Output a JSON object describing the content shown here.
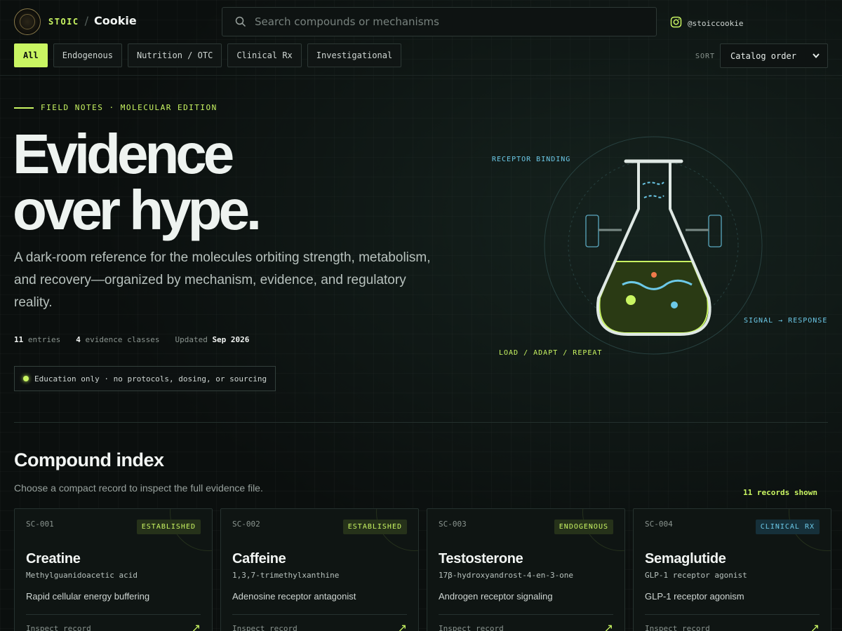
{
  "header": {
    "brand_prefix": "STOIC",
    "brand_separator": "/",
    "brand_name": "Cookie",
    "search_placeholder": "Search compounds or mechanisms",
    "social_handle": "@stoiccookie"
  },
  "filters": [
    {
      "label": "All",
      "active": true
    },
    {
      "label": "Endogenous",
      "active": false
    },
    {
      "label": "Nutrition / OTC",
      "active": false
    },
    {
      "label": "Clinical Rx",
      "active": false
    },
    {
      "label": "Investigational",
      "active": false
    }
  ],
  "sort": {
    "label": "SORT",
    "value": "Catalog order"
  },
  "hero": {
    "kicker": "FIELD NOTES · MOLECULAR EDITION",
    "title_line1": "Evidence",
    "title_line2": "over hype.",
    "subtitle": "A dark-room reference for the molecules orbiting strength, metabolism, and recovery—organized by mechanism, evidence, and regulatory reality.",
    "stats": {
      "entries_count": "11",
      "entries_label": "entries",
      "classes_count": "4",
      "classes_label": "evidence classes",
      "updated_label": "Updated",
      "updated_value": "Sep 2026"
    },
    "disclaimer": "Education only · no protocols, dosing, or sourcing"
  },
  "illustration": {
    "label_top": "RECEPTOR BINDING",
    "label_right": "SIGNAL → RESPONSE",
    "label_bottom": "LOAD / ADAPT / REPEAT"
  },
  "index": {
    "title": "Compound index",
    "subtitle": "Choose a compact record to inspect the full evidence file.",
    "count_text": "11 records shown",
    "cards": [
      {
        "id": "SC-001",
        "badge": "ESTABLISHED",
        "badge_tone": "green",
        "name": "Creatine",
        "chemical": "Methylguanidoacetic acid",
        "mechanism": "Rapid cellular energy buffering",
        "link": "Inspect record"
      },
      {
        "id": "SC-002",
        "badge": "ESTABLISHED",
        "badge_tone": "green",
        "name": "Caffeine",
        "chemical": "1,3,7-trimethylxanthine",
        "mechanism": "Adenosine receptor antagonist",
        "link": "Inspect record"
      },
      {
        "id": "SC-003",
        "badge": "ENDOGENOUS",
        "badge_tone": "green",
        "name": "Testosterone",
        "chemical": "17β-hydroxyandrost-4-en-3-one",
        "mechanism": "Androgen receptor signaling",
        "link": "Inspect record"
      },
      {
        "id": "SC-004",
        "badge": "CLINICAL RX",
        "badge_tone": "blue",
        "name": "Semaglutide",
        "chemical": "GLP-1 receptor agonist",
        "mechanism": "GLP-1 receptor agonism",
        "link": "Inspect record"
      }
    ]
  },
  "colors": {
    "accent": "#c9f562",
    "accent_blue": "#6cc9e8",
    "background": "#0b0f0e",
    "orange_dot": "#f07a4a"
  },
  "icons": {
    "logo": "stoic-cookie-logo-icon",
    "search": "search-icon",
    "social": "instagram-icon",
    "sort": "chevron-down-icon",
    "card_link": "arrow-up-right-icon",
    "hero_art": "flask-icon"
  }
}
